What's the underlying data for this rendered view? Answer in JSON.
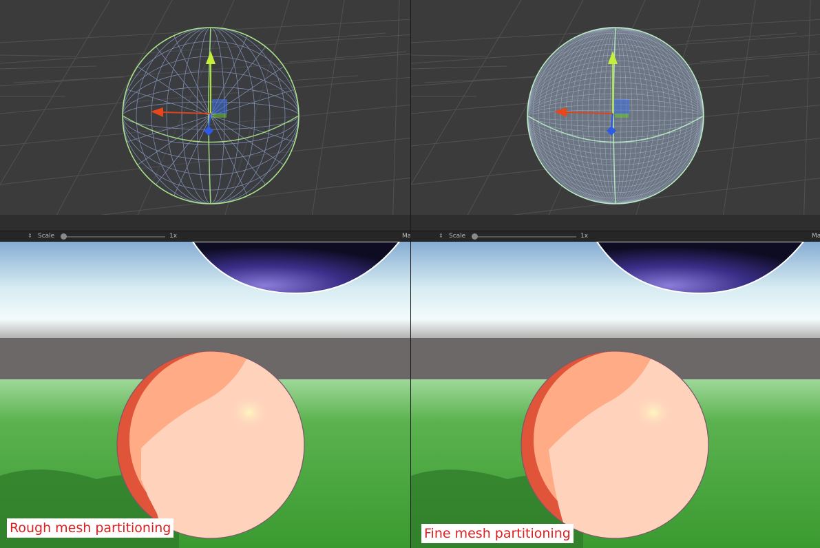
{
  "toolbar": {
    "scale_label": "Scale",
    "scale_value": "1x",
    "maximize_label": "Ma",
    "arrows_glyph": "⇕"
  },
  "captions": {
    "left": "Rough mesh partitioning",
    "right": "Fine mesh partitioning"
  },
  "colors": {
    "scene_background": "#3a3a3a",
    "sphere_outline": "#a8e28a",
    "wire": "#7f8fb4",
    "x_axis": "#e0441b",
    "y_axis": "#aee038",
    "z_axis": "#2d5be6",
    "sphere_main": "#ffab85",
    "sphere_shadow": "#e0553a",
    "sphere_highlight": "#ffd2bc",
    "grass": "#3e9b2f",
    "sky": "#bfe0ef",
    "caption_text": "#d81e1e"
  }
}
